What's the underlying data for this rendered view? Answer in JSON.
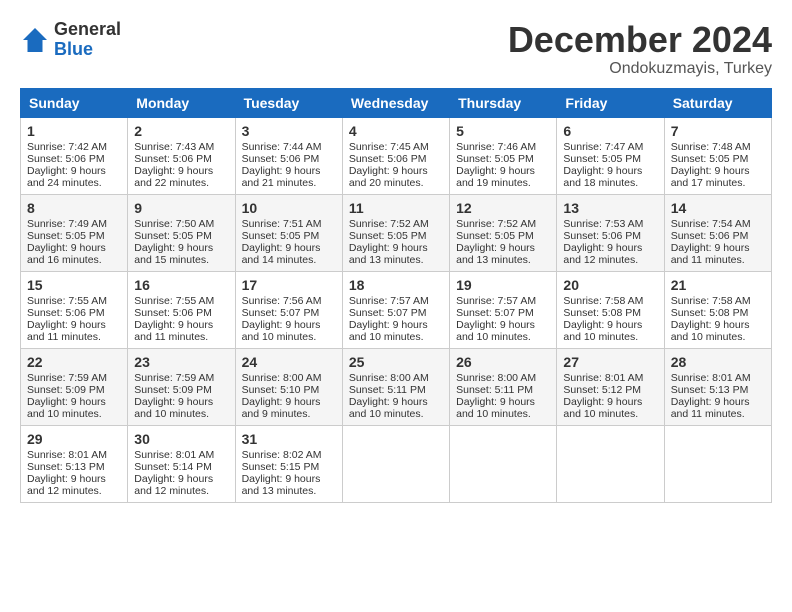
{
  "logo": {
    "general": "General",
    "blue": "Blue"
  },
  "title": "December 2024",
  "location": "Ondokuzmayis, Turkey",
  "weekdays": [
    "Sunday",
    "Monday",
    "Tuesday",
    "Wednesday",
    "Thursday",
    "Friday",
    "Saturday"
  ],
  "weeks": [
    [
      {
        "day": "1",
        "sunrise": "Sunrise: 7:42 AM",
        "sunset": "Sunset: 5:06 PM",
        "daylight": "Daylight: 9 hours and 24 minutes."
      },
      {
        "day": "2",
        "sunrise": "Sunrise: 7:43 AM",
        "sunset": "Sunset: 5:06 PM",
        "daylight": "Daylight: 9 hours and 22 minutes."
      },
      {
        "day": "3",
        "sunrise": "Sunrise: 7:44 AM",
        "sunset": "Sunset: 5:06 PM",
        "daylight": "Daylight: 9 hours and 21 minutes."
      },
      {
        "day": "4",
        "sunrise": "Sunrise: 7:45 AM",
        "sunset": "Sunset: 5:06 PM",
        "daylight": "Daylight: 9 hours and 20 minutes."
      },
      {
        "day": "5",
        "sunrise": "Sunrise: 7:46 AM",
        "sunset": "Sunset: 5:05 PM",
        "daylight": "Daylight: 9 hours and 19 minutes."
      },
      {
        "day": "6",
        "sunrise": "Sunrise: 7:47 AM",
        "sunset": "Sunset: 5:05 PM",
        "daylight": "Daylight: 9 hours and 18 minutes."
      },
      {
        "day": "7",
        "sunrise": "Sunrise: 7:48 AM",
        "sunset": "Sunset: 5:05 PM",
        "daylight": "Daylight: 9 hours and 17 minutes."
      }
    ],
    [
      {
        "day": "8",
        "sunrise": "Sunrise: 7:49 AM",
        "sunset": "Sunset: 5:05 PM",
        "daylight": "Daylight: 9 hours and 16 minutes."
      },
      {
        "day": "9",
        "sunrise": "Sunrise: 7:50 AM",
        "sunset": "Sunset: 5:05 PM",
        "daylight": "Daylight: 9 hours and 15 minutes."
      },
      {
        "day": "10",
        "sunrise": "Sunrise: 7:51 AM",
        "sunset": "Sunset: 5:05 PM",
        "daylight": "Daylight: 9 hours and 14 minutes."
      },
      {
        "day": "11",
        "sunrise": "Sunrise: 7:52 AM",
        "sunset": "Sunset: 5:05 PM",
        "daylight": "Daylight: 9 hours and 13 minutes."
      },
      {
        "day": "12",
        "sunrise": "Sunrise: 7:52 AM",
        "sunset": "Sunset: 5:05 PM",
        "daylight": "Daylight: 9 hours and 13 minutes."
      },
      {
        "day": "13",
        "sunrise": "Sunrise: 7:53 AM",
        "sunset": "Sunset: 5:06 PM",
        "daylight": "Daylight: 9 hours and 12 minutes."
      },
      {
        "day": "14",
        "sunrise": "Sunrise: 7:54 AM",
        "sunset": "Sunset: 5:06 PM",
        "daylight": "Daylight: 9 hours and 11 minutes."
      }
    ],
    [
      {
        "day": "15",
        "sunrise": "Sunrise: 7:55 AM",
        "sunset": "Sunset: 5:06 PM",
        "daylight": "Daylight: 9 hours and 11 minutes."
      },
      {
        "day": "16",
        "sunrise": "Sunrise: 7:55 AM",
        "sunset": "Sunset: 5:06 PM",
        "daylight": "Daylight: 9 hours and 11 minutes."
      },
      {
        "day": "17",
        "sunrise": "Sunrise: 7:56 AM",
        "sunset": "Sunset: 5:07 PM",
        "daylight": "Daylight: 9 hours and 10 minutes."
      },
      {
        "day": "18",
        "sunrise": "Sunrise: 7:57 AM",
        "sunset": "Sunset: 5:07 PM",
        "daylight": "Daylight: 9 hours and 10 minutes."
      },
      {
        "day": "19",
        "sunrise": "Sunrise: 7:57 AM",
        "sunset": "Sunset: 5:07 PM",
        "daylight": "Daylight: 9 hours and 10 minutes."
      },
      {
        "day": "20",
        "sunrise": "Sunrise: 7:58 AM",
        "sunset": "Sunset: 5:08 PM",
        "daylight": "Daylight: 9 hours and 10 minutes."
      },
      {
        "day": "21",
        "sunrise": "Sunrise: 7:58 AM",
        "sunset": "Sunset: 5:08 PM",
        "daylight": "Daylight: 9 hours and 10 minutes."
      }
    ],
    [
      {
        "day": "22",
        "sunrise": "Sunrise: 7:59 AM",
        "sunset": "Sunset: 5:09 PM",
        "daylight": "Daylight: 9 hours and 10 minutes."
      },
      {
        "day": "23",
        "sunrise": "Sunrise: 7:59 AM",
        "sunset": "Sunset: 5:09 PM",
        "daylight": "Daylight: 9 hours and 10 minutes."
      },
      {
        "day": "24",
        "sunrise": "Sunrise: 8:00 AM",
        "sunset": "Sunset: 5:10 PM",
        "daylight": "Daylight: 9 hours and 9 minutes."
      },
      {
        "day": "25",
        "sunrise": "Sunrise: 8:00 AM",
        "sunset": "Sunset: 5:11 PM",
        "daylight": "Daylight: 9 hours and 10 minutes."
      },
      {
        "day": "26",
        "sunrise": "Sunrise: 8:00 AM",
        "sunset": "Sunset: 5:11 PM",
        "daylight": "Daylight: 9 hours and 10 minutes."
      },
      {
        "day": "27",
        "sunrise": "Sunrise: 8:01 AM",
        "sunset": "Sunset: 5:12 PM",
        "daylight": "Daylight: 9 hours and 10 minutes."
      },
      {
        "day": "28",
        "sunrise": "Sunrise: 8:01 AM",
        "sunset": "Sunset: 5:13 PM",
        "daylight": "Daylight: 9 hours and 11 minutes."
      }
    ],
    [
      {
        "day": "29",
        "sunrise": "Sunrise: 8:01 AM",
        "sunset": "Sunset: 5:13 PM",
        "daylight": "Daylight: 9 hours and 12 minutes."
      },
      {
        "day": "30",
        "sunrise": "Sunrise: 8:01 AM",
        "sunset": "Sunset: 5:14 PM",
        "daylight": "Daylight: 9 hours and 12 minutes."
      },
      {
        "day": "31",
        "sunrise": "Sunrise: 8:02 AM",
        "sunset": "Sunset: 5:15 PM",
        "daylight": "Daylight: 9 hours and 13 minutes."
      },
      null,
      null,
      null,
      null
    ]
  ]
}
